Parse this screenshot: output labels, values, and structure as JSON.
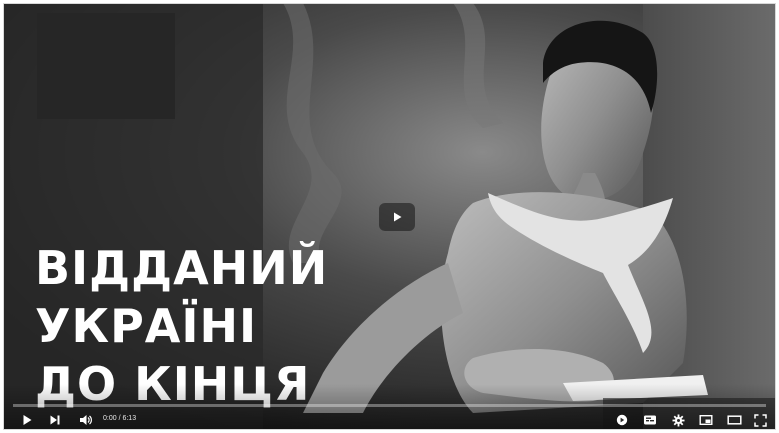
{
  "video": {
    "title_lines": [
      "ВІДДАНИЙ",
      "УКРАЇНІ",
      "ДО КІНЦЯ"
    ],
    "time": {
      "current": "0:00",
      "separator": " / ",
      "duration": "6:13"
    },
    "progress_fraction": 0.0
  },
  "controls": {
    "left": [
      {
        "name": "play-button",
        "icon": "play-icon"
      },
      {
        "name": "next-button",
        "icon": "skip-next-icon"
      },
      {
        "name": "volume-button",
        "icon": "volume-icon"
      }
    ],
    "right": [
      {
        "name": "autoplay-toggle",
        "icon": "autoplay-icon"
      },
      {
        "name": "subtitles-button",
        "icon": "subtitles-icon"
      },
      {
        "name": "settings-button",
        "icon": "gear-icon"
      },
      {
        "name": "miniplayer-button",
        "icon": "miniplayer-icon"
      },
      {
        "name": "theater-button",
        "icon": "theater-icon"
      },
      {
        "name": "fullscreen-button",
        "icon": "fullscreen-icon"
      }
    ]
  },
  "colors": {
    "overlay_text": "#ffffff",
    "control_icon": "#ffffff"
  }
}
